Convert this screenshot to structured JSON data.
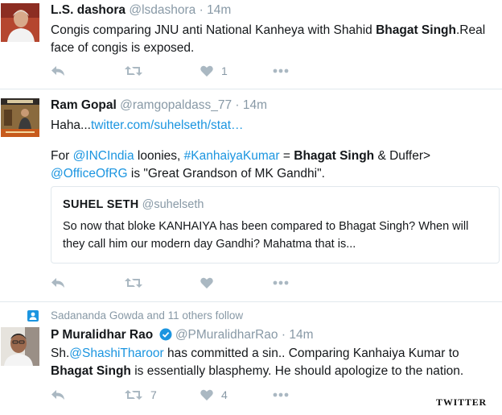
{
  "tweets": [
    {
      "name": "L.S. dashora",
      "handle": "@lsdashora",
      "dot": "·",
      "time": "14m",
      "text_parts": [
        "Congis comparing JNU anti National Kanheya with Shahid ",
        "Bhagat Singh",
        ".Real face of congis is exposed."
      ],
      "retweet_count": "",
      "like_count": "1",
      "avatar_icon": "person-photo-avatar"
    },
    {
      "name": "Ram Gopal",
      "handle": "@ramgopaldass_77",
      "dot": "·",
      "time": "14m",
      "line1_prefix": "Haha...",
      "line1_link": "twitter.com/suhelseth/stat…",
      "para2": {
        "p1": "For ",
        "mention1": "@INCIndia",
        "p2": " loonies, ",
        "hashtag": "#KanhaiyaKumar",
        "p3": " = ",
        "bold": "Bhagat Singh",
        "p4": " & Duffer>",
        "mention2": "@OfficeOfRG",
        "p5": " is \"Great Grandson of MK Gandhi\"."
      },
      "quote": {
        "name": "SUHEL SETH",
        "handle": "@suhelseth",
        "text": "So now that bloke KANHAIYA has been compared to Bhagat Singh? When will they call him our modern day Gandhi? Mahatma that is..."
      },
      "avatar_icon": "poster-avatar"
    },
    {
      "social_context": "Sadananda Gowda and 11 others follow",
      "name": "P Muralidhar Rao",
      "handle": "@PMuralidharRao",
      "dot": "·",
      "time": "14m",
      "text_parts": {
        "p1": "Sh.",
        "mention": "@ShashiTharoor",
        "p2": " has committed a sin.. Comparing Kanhaiya Kumar to ",
        "bold": "Bhagat Singh",
        "p3": " is essentially blasphemy. He should apologize to the nation."
      },
      "retweet_count": "7",
      "like_count": "4",
      "avatar_icon": "person-photo-avatar"
    }
  ],
  "watermark": "TWITTER",
  "colors": {
    "link": "#1b95e0",
    "muted": "#8899a6",
    "icon": "#aab8c2",
    "divider": "#e1e8ed"
  }
}
